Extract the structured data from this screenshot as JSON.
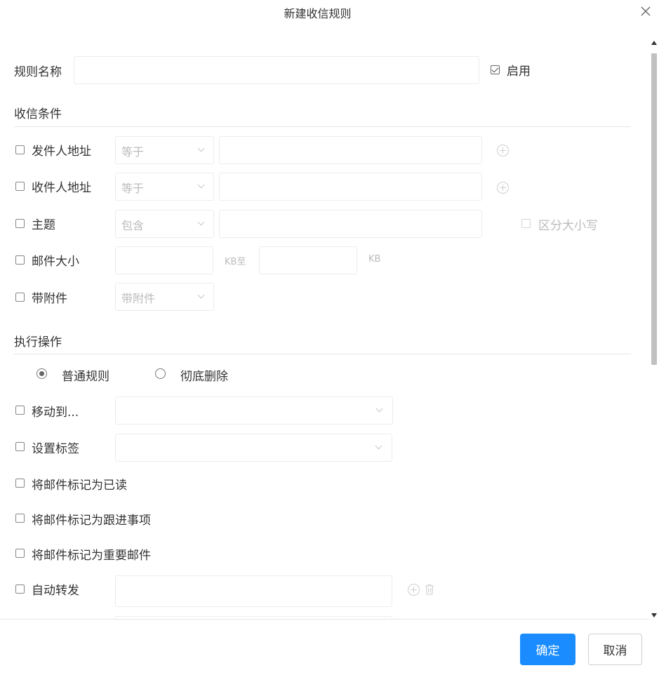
{
  "dialog": {
    "title": "新建收信规则"
  },
  "rule_name": {
    "label": "规则名称",
    "value": "",
    "enabled_label": "启用",
    "enabled": true
  },
  "conditions": {
    "title": "收信条件",
    "sender": {
      "label": "发件人地址",
      "operator": "等于",
      "value": ""
    },
    "recipient": {
      "label": "收件人地址",
      "operator": "等于",
      "value": ""
    },
    "subject": {
      "label": "主题",
      "operator": "包含",
      "value": "",
      "case_label": "区分大小写"
    },
    "size": {
      "label": "邮件大小",
      "min": "",
      "min_unit": "KB至",
      "max": "",
      "max_unit": "KB"
    },
    "attachment": {
      "label": "带附件",
      "value": "带附件"
    }
  },
  "actions": {
    "title": "执行操作",
    "mode_normal": "普通规则",
    "mode_delete": "彻底删除",
    "move_to": {
      "label": "移动到...",
      "value": ""
    },
    "set_tag": {
      "label": "设置标签",
      "value": ""
    },
    "mark_read": "将邮件标记为已读",
    "mark_followup": "将邮件标记为跟进事项",
    "mark_important": "将邮件标记为重要邮件",
    "forward": {
      "label": "自动转发",
      "value": ""
    }
  },
  "footer": {
    "ok": "确定",
    "cancel": "取消"
  },
  "colors": {
    "primary": "#1a8cff"
  }
}
